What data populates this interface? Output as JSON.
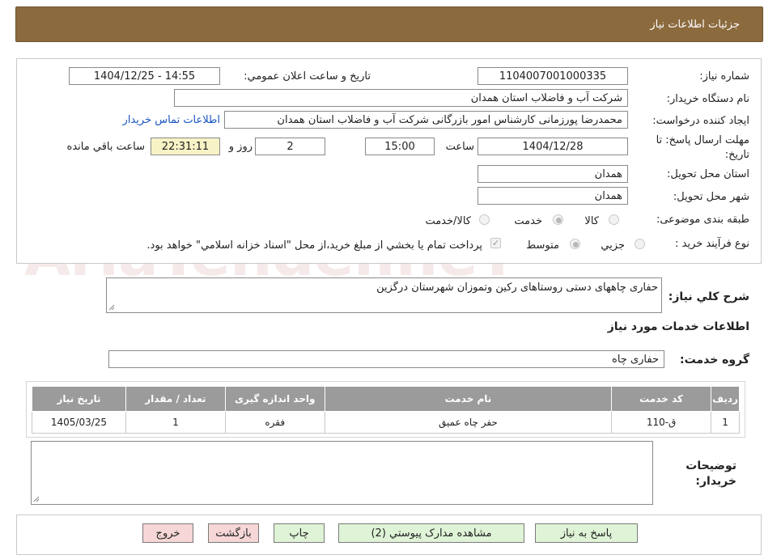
{
  "header": {
    "title": "جزئیات اطلاعات نیاز"
  },
  "fields": {
    "need_number_label": "شماره نیاز:",
    "need_number_value": "1104007001000335",
    "announce_label": "تاریخ و ساعت اعلان عمومي:",
    "announce_value": "1404/12/25 - 14:55",
    "buyer_label": "نام دستگاه خريدار:",
    "buyer_value": "شرکت آب و فاضلاب استان همدان",
    "creator_label": "ايجاد کننده درخواست:",
    "creator_value": "محمدرضا پورزمانی کارشناس امور بازرگانی شرکت آب و فاضلاب استان همدان",
    "contact_link": "اطلاعات تماس خريدار",
    "deadline_label_1": "مهلت ارسال پاسخ: تا",
    "deadline_label_2": "تاريخ:",
    "deadline_date": "1404/12/28",
    "time_label": "ساعت",
    "deadline_time": "15:00",
    "days_value": "2",
    "days_label": "روز و",
    "remaining_value": "22:31:11",
    "remaining_label": "ساعت باقي مانده",
    "province_label": "استان محل تحويل:",
    "province_value": "همدان",
    "city_label": "شهر محل تحويل:",
    "city_value": "همدان",
    "category_label": "طبقه بندی موضوعی:",
    "category_options": [
      "کالا",
      "خدمت",
      "کالا/خدمت"
    ],
    "process_label": "نوع فرآيند خريد :",
    "process_options": [
      "جزيي",
      "متوسط"
    ],
    "payment_note": "پرداخت تمام يا بخشي از مبلغ خريد،از محل \"اسناد خزانه اسلامي\" خواهد بود."
  },
  "description": {
    "label": "شرح کلي نياز:",
    "value": "حفاری چاههای دستی روستاهای رکین وتموزان شهرستان درگزین"
  },
  "services": {
    "section_title": "اطلاعات خدمات مورد نياز",
    "group_label": "گروه خدمت:",
    "group_value": "حفاری چاه",
    "columns": [
      "رديف",
      "کد خدمت",
      "نام خدمت",
      "واحد اندازه گيری",
      "تعداد / مقدار",
      "تاريخ نياز"
    ],
    "rows": [
      [
        "1",
        "ق-110",
        "حفر چاه عميق",
        "فقره",
        "1",
        "1405/03/25"
      ]
    ]
  },
  "buyer_notes": {
    "label_1": "توضيحات",
    "label_2": "خريدار:",
    "value": ""
  },
  "buttons": {
    "reply": "پاسخ به نياز",
    "docs": "مشاهده مدارک پيوستي (2)",
    "print": "چاپ",
    "back": "بازگشت",
    "exit": "خروج"
  },
  "watermark": {
    "text": "AriaTender.neT"
  },
  "colors": {
    "header_bg": "#8b6a3e",
    "table_header_bg": "#9b9b9b",
    "button_green": "#dff3d6",
    "button_pink": "#f6d6d6",
    "remaining_bg": "#f7f3c6",
    "link": "#1a55c4"
  }
}
